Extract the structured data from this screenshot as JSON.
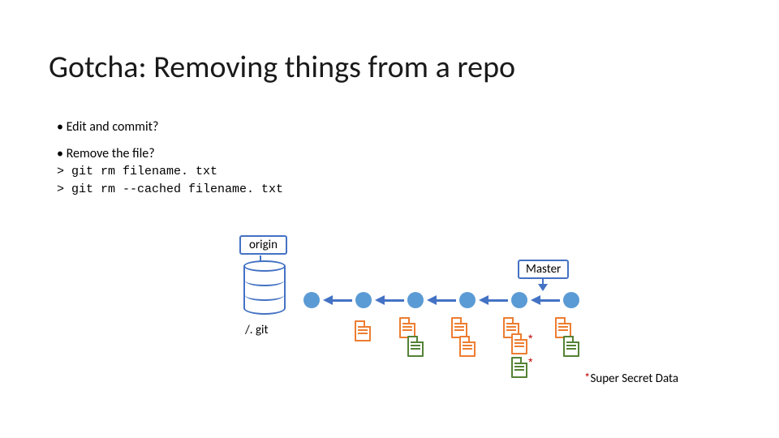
{
  "slide": {
    "title": "Gotcha: Removing things from a repo",
    "bullet1": "Edit and commit?",
    "bullet2": "Remove the file?",
    "cmd1": "> git rm filename. txt",
    "cmd2": "> git rm --cached filename. txt"
  },
  "diagram": {
    "origin_label": "origin",
    "repo_label": "/. git",
    "master_label": "Master",
    "footnote_star": "*",
    "footnote_text": "Super Secret Data",
    "star": "*"
  },
  "colors": {
    "accent": "#4472c4",
    "commit": "#5b9bd5",
    "doc_orange": "#ed7d31",
    "doc_green": "#548235",
    "footnote_red": "#C00000"
  }
}
